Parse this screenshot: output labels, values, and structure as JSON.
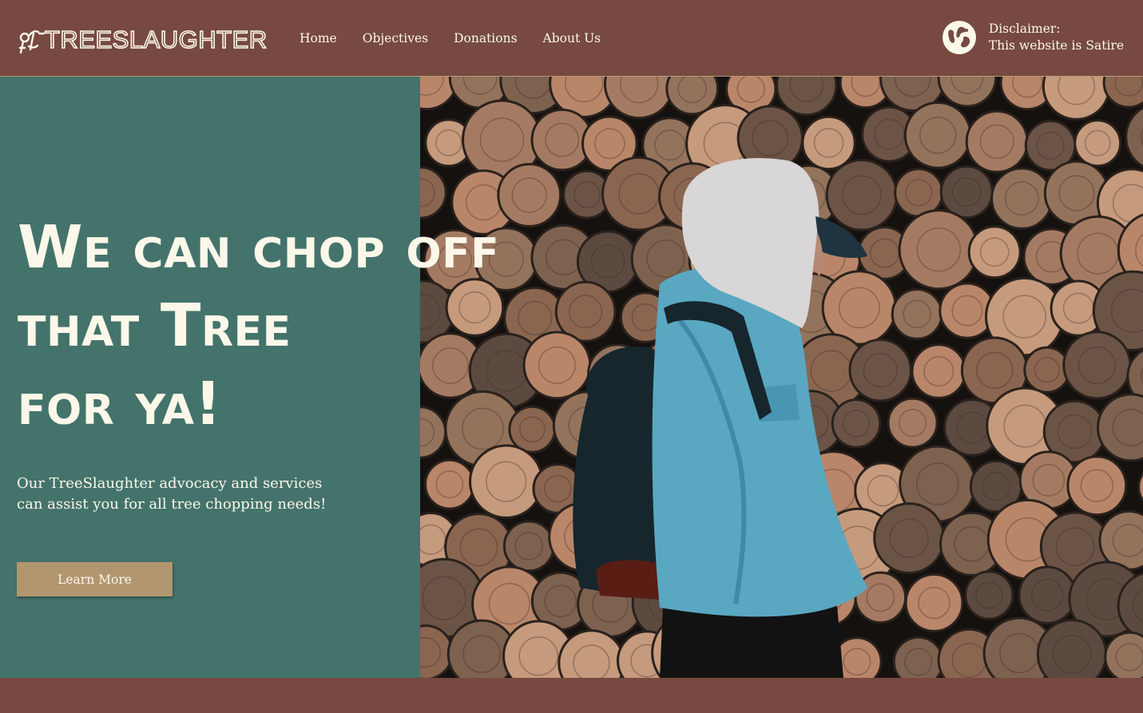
{
  "brand": {
    "name": "TREESLAUGHTER",
    "logo_icon": "tree-axe-icon"
  },
  "nav": {
    "items": [
      {
        "label": "Home"
      },
      {
        "label": "Objectives"
      },
      {
        "label": "Donations"
      },
      {
        "label": "About Us"
      }
    ]
  },
  "disclaimer": {
    "icon": "globe-icon",
    "line1": "Disclaimer:",
    "line2": "This website is Satire"
  },
  "hero": {
    "headline_lines": [
      "We can chop off",
      "that Tree",
      "for ya!"
    ],
    "subtext": "Our TreeSlaughter advocacy and services can assist you for all tree chopping needs!",
    "cta_label": "Learn More",
    "photo_alt": "person-in-hoodie-in-front-of-log-pile"
  },
  "colors": {
    "header_bg": "#774940",
    "hero_panel": "#44736c",
    "cream_text": "#fbf8ea",
    "button_bg": "#b2966f"
  }
}
